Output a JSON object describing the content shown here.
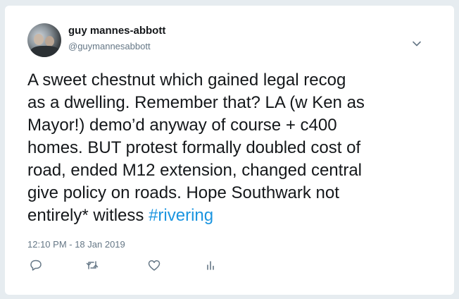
{
  "tweet": {
    "author_name": "guy mannes-abbott",
    "author_handle": "@guymannesabbott",
    "text_lines": [
      "A sweet chestnut which gained legal recog",
      "as a dwelling. Remember that? LA (w Ken as",
      "Mayor!) demo’d anyway of course + c400",
      "homes. BUT protest formally doubled cost of",
      "road, ended M12 extension, changed central",
      "give policy on roads. Hope Southwark not"
    ],
    "last_line_text": "entirely* witless ",
    "hashtag": "#rivering",
    "timestamp": "12:10 PM - 18 Jan 2019"
  },
  "icons": {
    "menu": "chevron-down-icon",
    "reply": "reply-icon",
    "retweet": "retweet-icon",
    "like": "heart-icon",
    "analytics": "analytics-icon"
  },
  "colors": {
    "text": "#14171a",
    "secondary": "#657786",
    "link": "#1b95e0",
    "background": "#e6ecf0",
    "card": "#ffffff"
  }
}
